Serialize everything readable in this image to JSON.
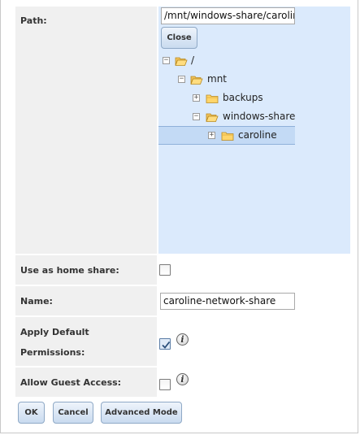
{
  "path": {
    "label": "Path:",
    "value": "/mnt/windows-share/caroline",
    "close_label": "Close",
    "tree": [
      {
        "label": "/",
        "expanded": true,
        "icon": "folder-open-icon"
      },
      {
        "label": "mnt",
        "expanded": true,
        "icon": "folder-open-icon"
      },
      {
        "label": "backups",
        "expanded": false,
        "icon": "folder-icon"
      },
      {
        "label": "windows-share",
        "expanded": true,
        "icon": "folder-open-icon"
      },
      {
        "label": "caroline",
        "expanded": false,
        "selected": true,
        "icon": "folder-icon"
      }
    ]
  },
  "home_share": {
    "label": "Use as home share:",
    "checked": false
  },
  "name": {
    "label": "Name:",
    "value": "caroline-network-share"
  },
  "apply_perms": {
    "label_line1": "Apply Default",
    "label_line2": "Permissions:",
    "checked": true
  },
  "guest_access": {
    "label": "Allow Guest Access:",
    "checked": false
  },
  "buttons": {
    "ok": "OK",
    "cancel": "Cancel",
    "advanced": "Advanced Mode"
  },
  "colors": {
    "tree_background": "#dbeafc",
    "label_background": "#f0f0f0",
    "button_border": "#8fa9c6"
  }
}
